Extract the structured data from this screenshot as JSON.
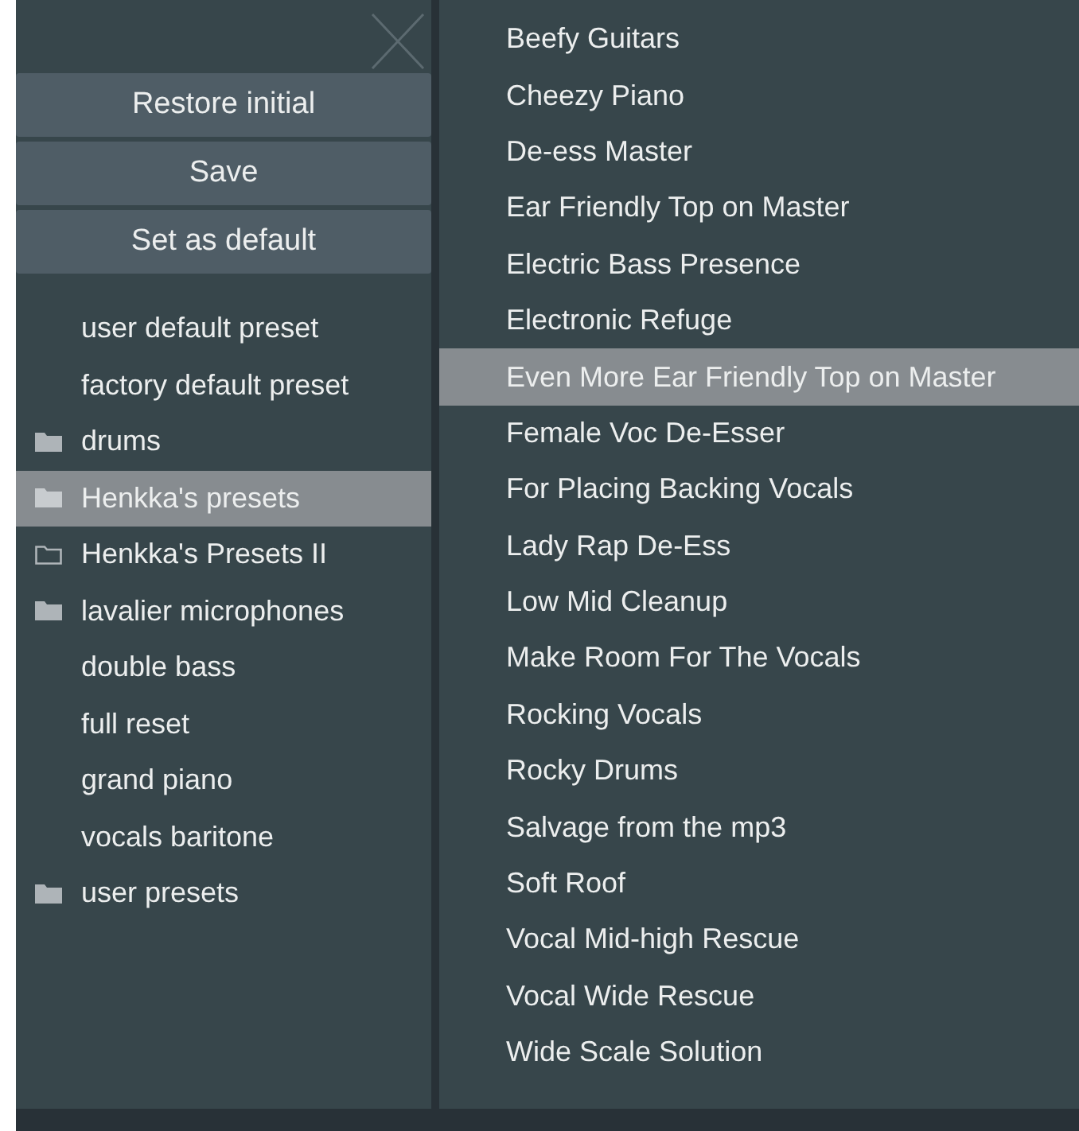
{
  "buttons": [
    "Restore initial",
    "Save",
    "Set as default"
  ],
  "folders": [
    {
      "label": "user default preset",
      "kind": "preset",
      "selected": false
    },
    {
      "label": "factory default preset",
      "kind": "preset",
      "selected": false
    },
    {
      "label": "drums",
      "kind": "folder",
      "selected": false
    },
    {
      "label": "Henkka's presets",
      "kind": "folder",
      "selected": true
    },
    {
      "label": "Henkka's Presets II",
      "kind": "folder-outline",
      "selected": false
    },
    {
      "label": "lavalier microphones",
      "kind": "folder",
      "selected": false
    },
    {
      "label": "double bass",
      "kind": "preset",
      "selected": false
    },
    {
      "label": "full reset",
      "kind": "preset",
      "selected": false
    },
    {
      "label": "grand piano",
      "kind": "preset",
      "selected": false
    },
    {
      "label": "vocals baritone",
      "kind": "preset",
      "selected": false
    },
    {
      "label": "user presets",
      "kind": "folder",
      "selected": false
    }
  ],
  "presets": [
    {
      "label": "Beefy Guitars",
      "selected": false
    },
    {
      "label": "Cheezy Piano",
      "selected": false
    },
    {
      "label": "De-ess Master",
      "selected": false
    },
    {
      "label": "Ear Friendly Top on Master",
      "selected": false
    },
    {
      "label": "Electric Bass Presence",
      "selected": false
    },
    {
      "label": "Electronic Refuge",
      "selected": false
    },
    {
      "label": "Even More Ear Friendly Top on Master",
      "selected": true
    },
    {
      "label": "Female Voc De-Esser",
      "selected": false
    },
    {
      "label": "For Placing Backing Vocals",
      "selected": false
    },
    {
      "label": "Lady Rap De-Ess",
      "selected": false
    },
    {
      "label": "Low Mid Cleanup",
      "selected": false
    },
    {
      "label": "Make Room For The Vocals",
      "selected": false
    },
    {
      "label": "Rocking Vocals",
      "selected": false
    },
    {
      "label": "Rocky Drums",
      "selected": false
    },
    {
      "label": "Salvage from the mp3",
      "selected": false
    },
    {
      "label": "Soft Roof",
      "selected": false
    },
    {
      "label": "Vocal Mid-high Rescue",
      "selected": false
    },
    {
      "label": "Vocal Wide Rescue",
      "selected": false
    },
    {
      "label": "Wide Scale Solution",
      "selected": false
    }
  ]
}
